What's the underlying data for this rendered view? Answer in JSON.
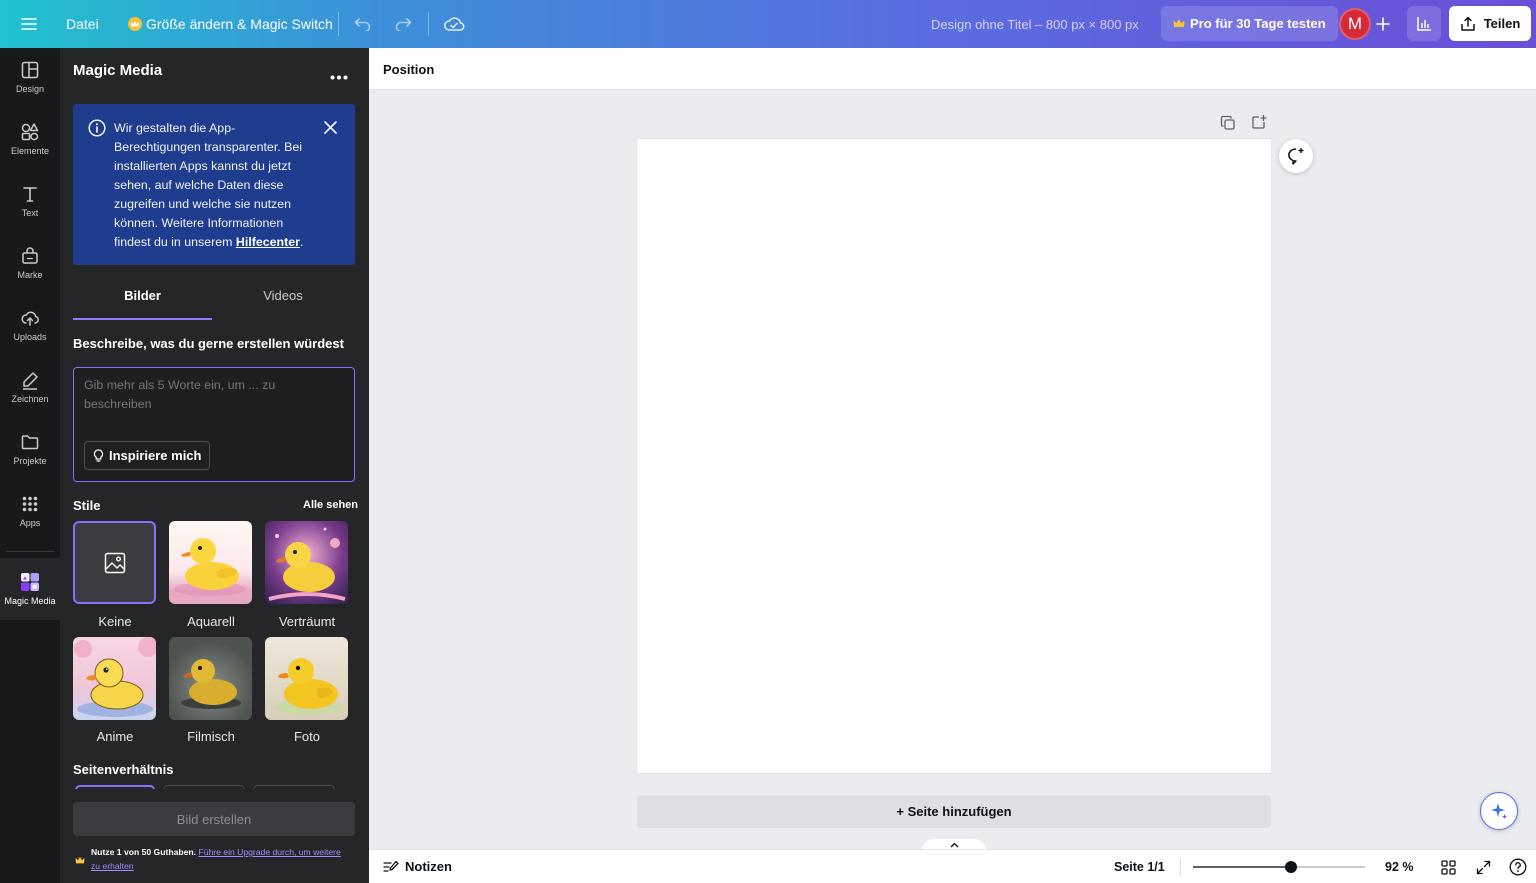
{
  "topbar": {
    "file_label": "Datei",
    "resize_label": "Größe ändern & Magic Switch",
    "design_title": "Design ohne Titel – 800 px × 800 px",
    "pro_trial_label": "Pro für 30 Tage testen",
    "avatar_initial": "M",
    "share_label": "Teilen"
  },
  "rail": {
    "items": [
      {
        "label": "Design",
        "icon": "layout-icon"
      },
      {
        "label": "Elemente",
        "icon": "shapes-icon"
      },
      {
        "label": "Text",
        "icon": "text-icon"
      },
      {
        "label": "Marke",
        "icon": "brand-icon"
      },
      {
        "label": "Uploads",
        "icon": "cloud-upload-icon"
      },
      {
        "label": "Zeichnen",
        "icon": "draw-icon"
      },
      {
        "label": "Projekte",
        "icon": "folder-icon"
      },
      {
        "label": "Apps",
        "icon": "apps-grid-icon"
      },
      {
        "label": "Magic Media",
        "icon": "magic-media-icon"
      }
    ]
  },
  "panel": {
    "title": "Magic Media",
    "notice": {
      "text": "Wir gestalten die App-Berechtigungen transparenter. Bei installierten Apps kannst du jetzt sehen, auf welche Daten diese zugreifen und welche sie nutzen können. Weitere Informationen findest du in unserem ",
      "link": "Hilfecenter",
      "suffix": "."
    },
    "tabs": {
      "images": "Bilder",
      "videos": "Videos",
      "active": "Bilder"
    },
    "prompt_label": "Beschreibe, was du gerne erstellen würdest",
    "prompt_placeholder": "Gib mehr als 5 Worte ein, um ... zu beschreiben",
    "prompt_value": "",
    "inspire_label": "Inspiriere mich",
    "styles_heading": "Stile",
    "see_all": "Alle sehen",
    "styles": [
      {
        "label": "Keine",
        "selected": true
      },
      {
        "label": "Aquarell",
        "selected": false
      },
      {
        "label": "Verträumt",
        "selected": false
      },
      {
        "label": "Anime",
        "selected": false
      },
      {
        "label": "Filmisch",
        "selected": false
      },
      {
        "label": "Foto",
        "selected": false
      }
    ],
    "aspect_heading": "Seitenverhältnis",
    "create_label": "Bild erstellen",
    "credits_text": "Nutze 1 von 50 Guthaben.",
    "upgrade_link": "Führe ein Upgrade durch, um weitere zu erhalten"
  },
  "editor": {
    "context_label": "Position",
    "add_page": "+ Seite hinzufügen"
  },
  "bottombar": {
    "notes_label": "Notizen",
    "page_indicator": "Seite 1/1",
    "zoom_label": "92 %",
    "zoom_fraction": 0.57
  },
  "colors": {
    "accent": "#8b3dff",
    "notice_bg": "#1f3d8f",
    "panel_bg": "#252627",
    "rail_bg": "#18191b",
    "avatar_bg": "#d42a3a"
  }
}
